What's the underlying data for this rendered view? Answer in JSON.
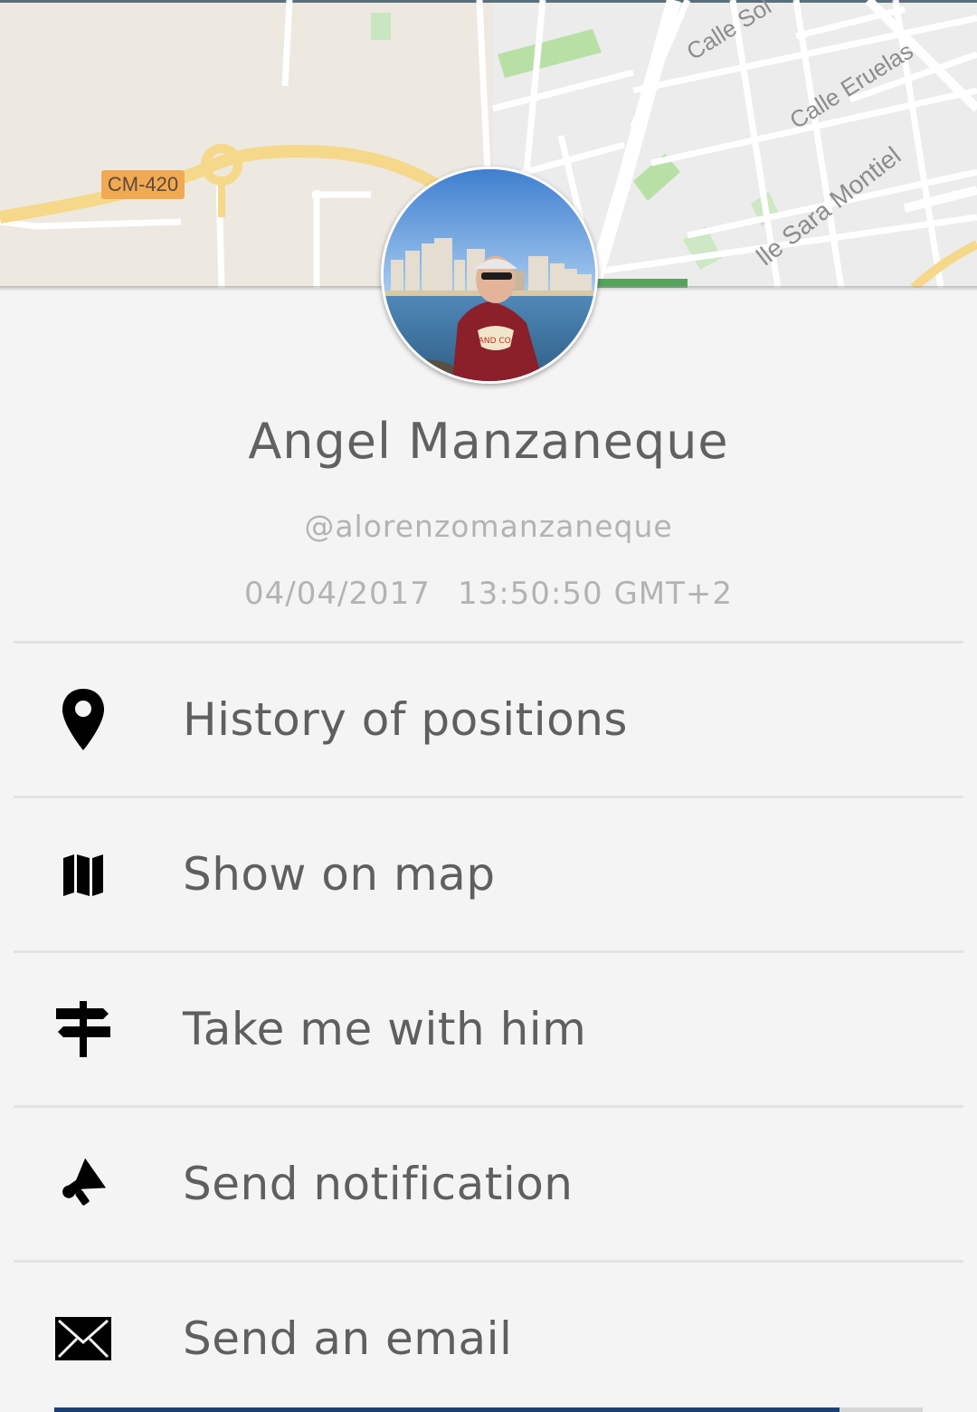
{
  "map": {
    "road_label": "CM-420",
    "street_labels": [
      "Calle Sol",
      "Calle Eruelas",
      "lle Sara Montiel"
    ],
    "road_color": "#f6d88a",
    "label_color": "#f2a953"
  },
  "profile": {
    "name": "Angel Manzaneque",
    "username": "@alorenzomanzaneque",
    "date": "04/04/2017",
    "time": "13:50:50 GMT+2"
  },
  "menu": {
    "items": [
      {
        "label": "History of positions",
        "icon": "location-pin-icon"
      },
      {
        "label": "Show on map",
        "icon": "map-icon"
      },
      {
        "label": "Take me with him",
        "icon": "signpost-icon"
      },
      {
        "label": "Send notification",
        "icon": "megaphone-icon"
      },
      {
        "label": "Send an email",
        "icon": "envelope-icon"
      }
    ]
  },
  "colors": {
    "background": "#f4f4f4",
    "name_text": "#616161",
    "secondary_text": "#b3b3b3",
    "menu_text": "#5f5f5f",
    "divider": "#e3e3e3",
    "accent_bar": "#1e3f73"
  }
}
